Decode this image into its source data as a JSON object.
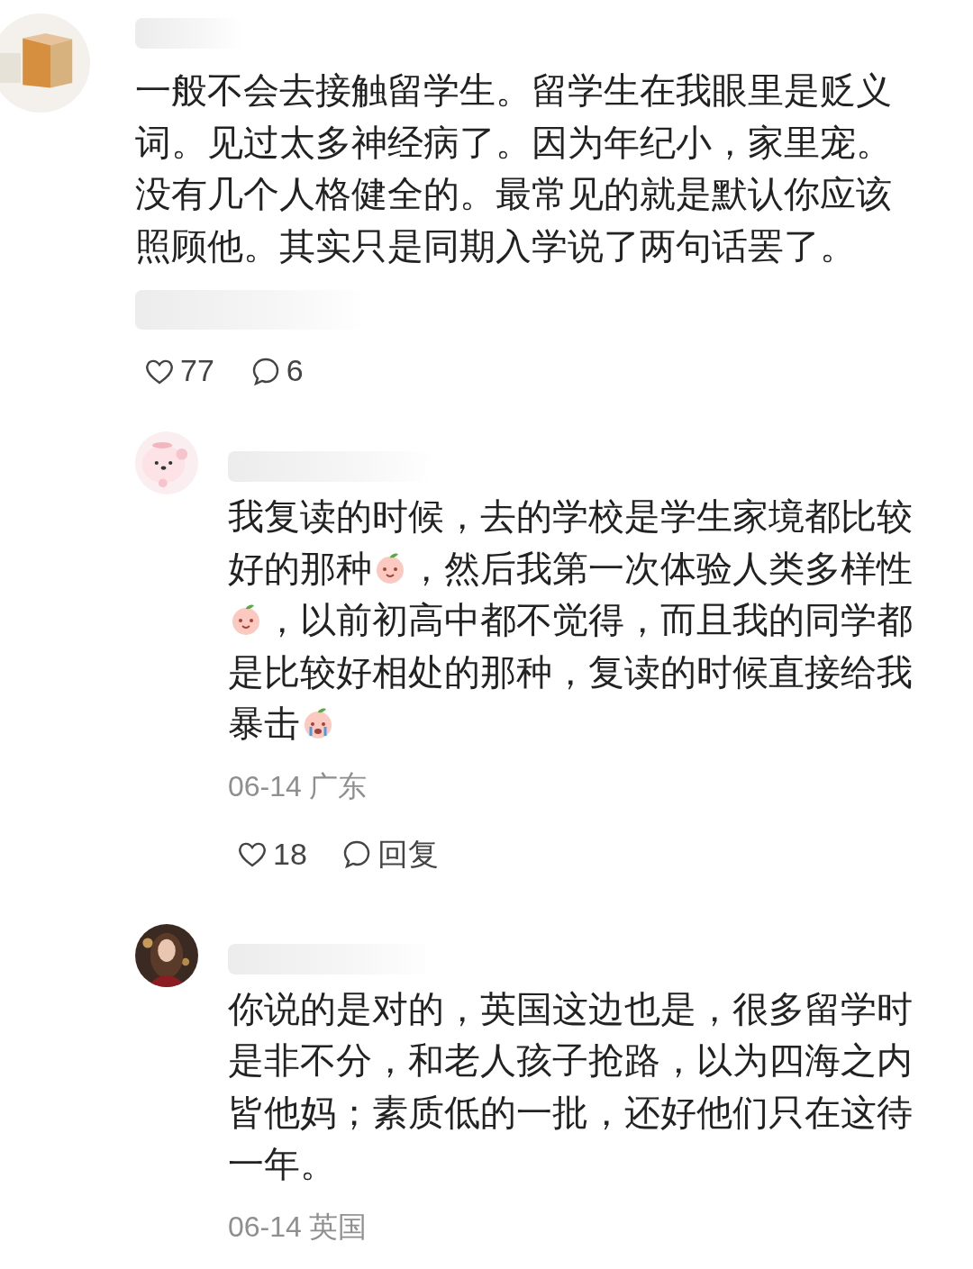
{
  "comments": [
    {
      "avatar": {
        "kind": "box"
      },
      "parts": [
        {
          "kind": "text",
          "text": "一般不会去接触留学生。留学生在我眼里是贬义词。见过太多神经病了。因为年纪小，家里宠。没有几个人格健全的。最常见的就是默认你应该照顾他。其实只是同期入学说了两句话罢了。"
        }
      ],
      "likes": "77",
      "replies": "6",
      "children": [
        {
          "avatar": {
            "kind": "cartoon"
          },
          "parts": [
            {
              "kind": "text",
              "text": "我复读的时候，去的学校是学生家境都比较"
            },
            {
              "kind": "text",
              "text": "好的那种"
            },
            {
              "kind": "emoji_smile"
            },
            {
              "kind": "text",
              "text": "，然后我第一次体验人类多样性"
            },
            {
              "kind": "emoji_smile"
            },
            {
              "kind": "text",
              "text": "，以前初高中都不觉得，而且我的同学都"
            },
            {
              "kind": "text",
              "text": "是比较好相处的那种，复读的时候直接给我"
            },
            {
              "kind": "text",
              "text": "暴击"
            },
            {
              "kind": "emoji_cry"
            }
          ],
          "date": "06-14",
          "location": "广东",
          "likes": "18",
          "reply_label": "回复"
        },
        {
          "avatar": {
            "kind": "portrait"
          },
          "parts": [
            {
              "kind": "text",
              "text": "你说的是对的，英国这边也是，很多留学时是非不分，和老人孩子抢路，以为四海之内皆他妈；素质低的一批，还好他们只在这待一年。"
            }
          ],
          "date": "06-14",
          "location": "英国"
        }
      ]
    }
  ]
}
